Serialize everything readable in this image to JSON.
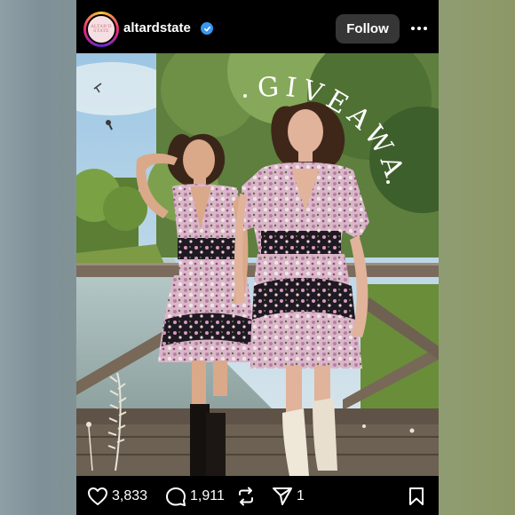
{
  "post": {
    "username": "altardstate",
    "avatar_text": "ALTAR'D STATE",
    "follow_label": "Follow",
    "image_overlay_text": "GIVEAWAY",
    "likes": "3,833",
    "comments": "1,911",
    "shares": "1"
  },
  "icons": [
    "verified-badge-icon",
    "more-options-icon",
    "heart-icon",
    "comment-icon",
    "repost-icon",
    "share-icon",
    "bookmark-icon"
  ],
  "colors": {
    "background": "#000000",
    "follow_button": "#363636",
    "verified": "#3897f0",
    "text": "#ffffff"
  }
}
